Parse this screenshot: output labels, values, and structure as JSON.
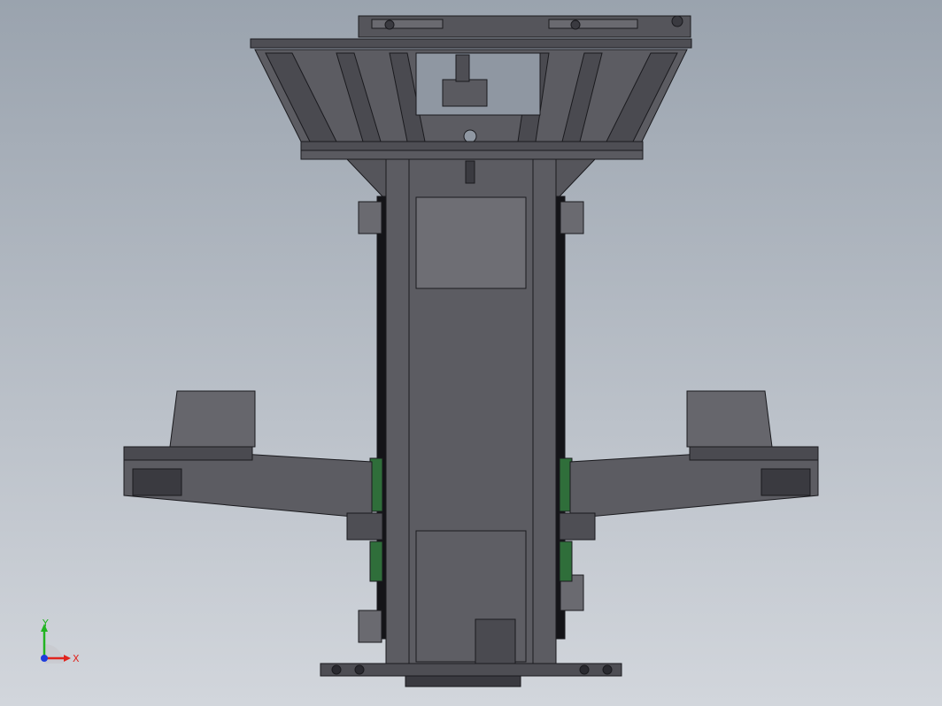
{
  "viewport": {
    "background_top": "#9aa3ae",
    "background_bottom": "#d2d6dc",
    "model_color": "#5a5a60",
    "edge_color": "#1a1a1e",
    "panel_color": "#6e6e74",
    "accent_wood": "#8a6a3a",
    "accent_green": "#2f6e3a"
  },
  "triad": {
    "x_label": "X",
    "y_label": "Y",
    "x_color": "#e0241e",
    "y_color": "#22b422",
    "z_color": "#1e3cdc"
  }
}
